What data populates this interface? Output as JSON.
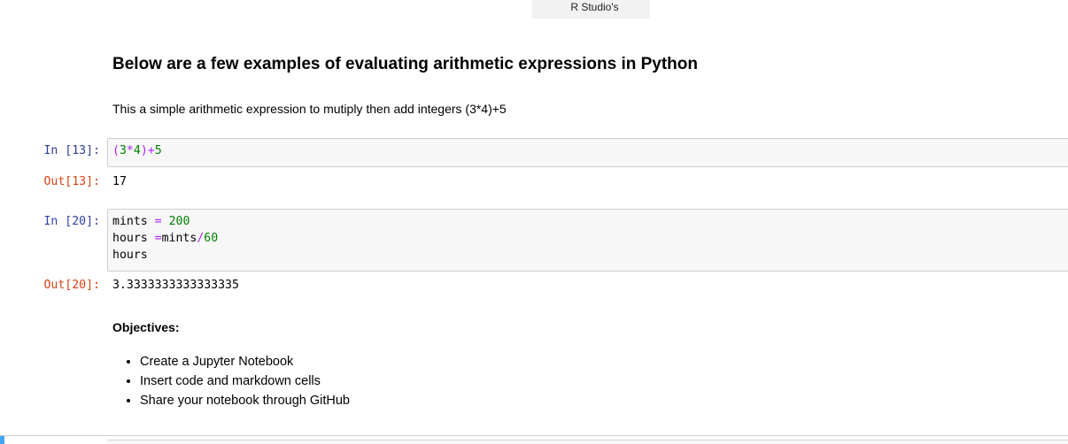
{
  "top_tab": {
    "label": "R Studio's"
  },
  "markdown": {
    "heading": "Below are a few examples of evaluating arithmetic expressions in Python",
    "description": "This a simple arithmetic expression to mutiply then add integers (3*4)+5"
  },
  "cells": [
    {
      "in_prompt": "In [13]:",
      "out_prompt": "Out[13]:",
      "code_lines": [
        "(3*4)+5"
      ],
      "output": "17"
    },
    {
      "in_prompt": "In [20]:",
      "out_prompt": "Out[20]:",
      "code_lines": [
        "mints = 200",
        "hours =mints/60",
        "hours"
      ],
      "output": "3.3333333333333335"
    }
  ],
  "objectives": {
    "heading": "Objectives:",
    "items": [
      "Create a Jupyter Notebook",
      "Insert code and markdown cells",
      "Share your notebook through GitHub"
    ]
  },
  "colors": {
    "in_prompt": "#303f9f",
    "out_prompt": "#d84315",
    "number": "#008000",
    "operator": "#aa22ff",
    "active_cell_bar": "#42a5f5"
  }
}
